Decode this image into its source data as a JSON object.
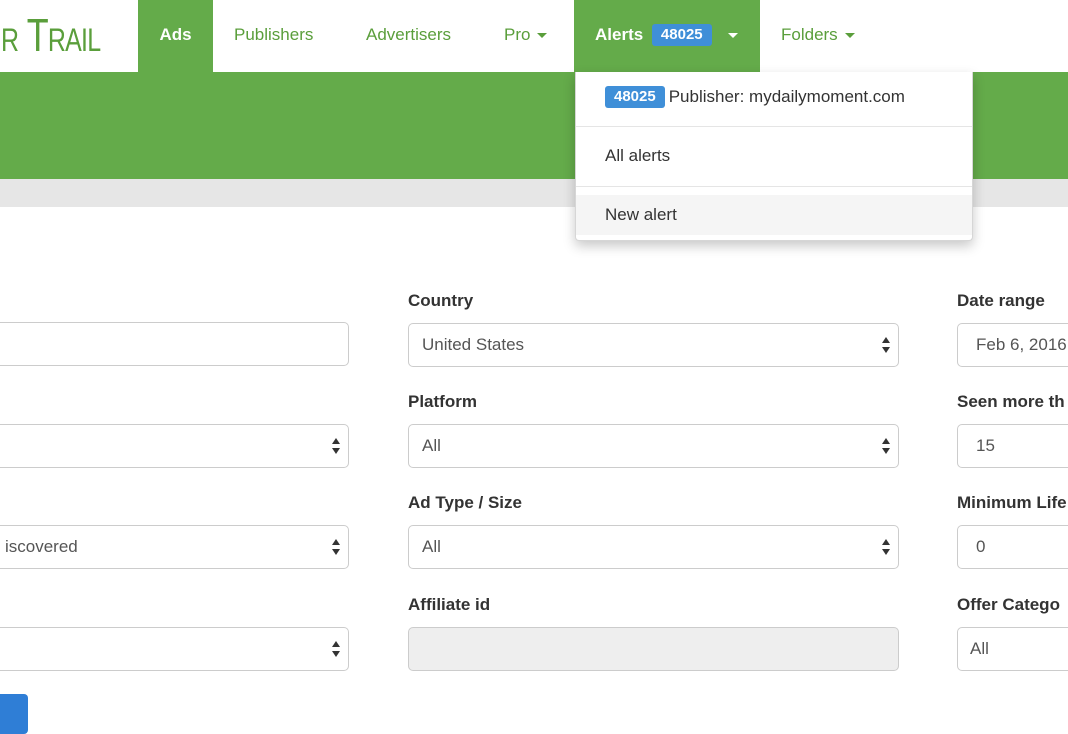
{
  "brand": {
    "logo_text": "r Trail"
  },
  "nav": {
    "ads": "Ads",
    "publishers": "Publishers",
    "advertisers": "Advertisers",
    "pro": "Pro",
    "alerts": "Alerts",
    "alerts_count": "48025",
    "folders": "Folders"
  },
  "alerts_menu": {
    "alert_badge": "48025",
    "alert_label": "Publisher: mydailymoment.com",
    "all_alerts": "All alerts",
    "new_alert": "New alert"
  },
  "form": {
    "left": {
      "field2_value": "",
      "field3_value": "iscovered",
      "field4_value": ""
    },
    "country": {
      "label": "Country",
      "value": "United States"
    },
    "platform": {
      "label": "Platform",
      "value": "All"
    },
    "ad_type": {
      "label": "Ad Type / Size",
      "value": "All"
    },
    "affiliate": {
      "label": "Affiliate id",
      "value": ""
    },
    "date_range": {
      "label": "Date range",
      "value": "Feb 6, 2016"
    },
    "seen_more": {
      "label": "Seen more th",
      "value": "15"
    },
    "min_life": {
      "label": "Minimum Life",
      "value": "0"
    },
    "offer_category": {
      "label": "Offer Catego",
      "value": "All"
    }
  },
  "colors": {
    "brand_green": "#64ab4a",
    "badge_blue": "#3f8fd8",
    "button_blue": "#2f7ed6"
  }
}
